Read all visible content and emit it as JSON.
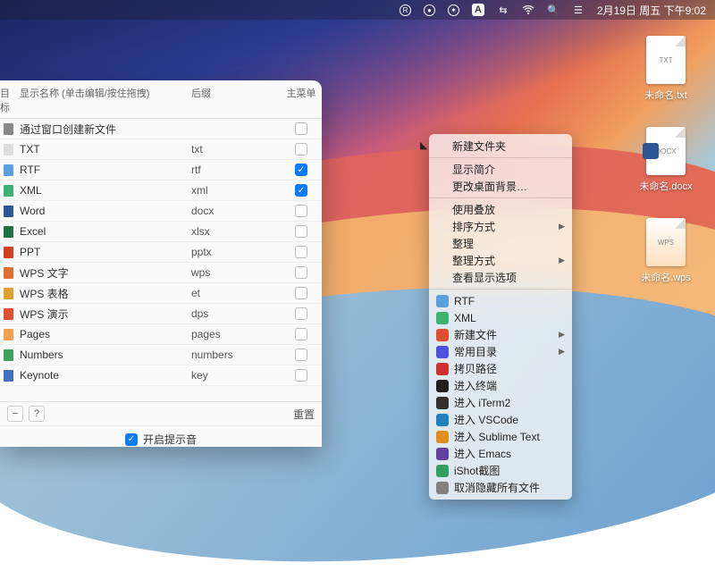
{
  "menubar": {
    "datetime": "2月19日 周五 下午9:02",
    "icons": [
      "R",
      "●",
      "⊕",
      "A",
      "⇄",
      "wifi",
      "⌕",
      "≡"
    ]
  },
  "desktop_files": [
    {
      "name": "未命名.txt",
      "badge": "TXT",
      "kind": "txt"
    },
    {
      "name": "未命名.docx",
      "badge": "DOCX",
      "kind": "docx"
    },
    {
      "name": "未命名.wps",
      "badge": "WPS",
      "kind": "wps"
    }
  ],
  "prefs": {
    "columns": {
      "icon": "目标",
      "name": "显示名称 (单击编辑/按住拖拽)",
      "ext": "后缀",
      "menu": "主菜单"
    },
    "rows": [
      {
        "icon_color": "#888",
        "name": "通过窗口创建新文件",
        "ext": "",
        "checked": false
      },
      {
        "icon_color": "#ddd",
        "name": "TXT",
        "ext": "txt",
        "checked": false
      },
      {
        "icon_color": "#5aa0e0",
        "name": "RTF",
        "ext": "rtf",
        "checked": true
      },
      {
        "icon_color": "#3cb371",
        "name": "XML",
        "ext": "xml",
        "checked": true
      },
      {
        "icon_color": "#2b5797",
        "name": "Word",
        "ext": "docx",
        "checked": false
      },
      {
        "icon_color": "#1e7145",
        "name": "Excel",
        "ext": "xlsx",
        "checked": false
      },
      {
        "icon_color": "#d04020",
        "name": "PPT",
        "ext": "pptx",
        "checked": false
      },
      {
        "icon_color": "#e07030",
        "name": "WPS 文字",
        "ext": "wps",
        "checked": false
      },
      {
        "icon_color": "#e0a030",
        "name": "WPS 表格",
        "ext": "et",
        "checked": false
      },
      {
        "icon_color": "#e05030",
        "name": "WPS 演示",
        "ext": "dps",
        "checked": false
      },
      {
        "icon_color": "#f0a050",
        "name": "Pages",
        "ext": "pages",
        "checked": false
      },
      {
        "icon_color": "#40a060",
        "name": "Numbers",
        "ext": "numbers",
        "checked": false
      },
      {
        "icon_color": "#4070c0",
        "name": "Keynote",
        "ext": "key",
        "checked": false
      }
    ],
    "footer": {
      "remove": "−",
      "help": "?",
      "reset": "重置"
    },
    "bottom_toggle": "开启提示音"
  },
  "context_menu": {
    "groups": [
      [
        {
          "label": "新建文件夹",
          "icon": null,
          "submenu": false,
          "cursor": true
        }
      ],
      [
        {
          "label": "显示简介",
          "icon": null,
          "submenu": false
        },
        {
          "label": "更改桌面背景…",
          "icon": null,
          "submenu": false
        }
      ],
      [
        {
          "label": "使用叠放",
          "icon": null,
          "submenu": false
        },
        {
          "label": "排序方式",
          "icon": null,
          "submenu": true
        },
        {
          "label": "整理",
          "icon": null,
          "submenu": false
        },
        {
          "label": "整理方式",
          "icon": null,
          "submenu": true
        },
        {
          "label": "查看显示选项",
          "icon": null,
          "submenu": false
        }
      ],
      [
        {
          "label": "RTF",
          "icon": "#5aa0e0",
          "submenu": false
        },
        {
          "label": "XML",
          "icon": "#3cb371",
          "submenu": false
        },
        {
          "label": "新建文件",
          "icon": "#e05030",
          "submenu": true
        },
        {
          "label": "常用目录",
          "icon": "#5050e0",
          "submenu": true
        },
        {
          "label": "拷贝路径",
          "icon": "#d03030",
          "submenu": false
        },
        {
          "label": "进入终端",
          "icon": "#202020",
          "submenu": false
        },
        {
          "label": "进入 iTerm2",
          "icon": "#303030",
          "submenu": false
        },
        {
          "label": "进入 VSCode",
          "icon": "#2080c0",
          "submenu": false
        },
        {
          "label": "进入 Sublime Text",
          "icon": "#e09020",
          "submenu": false
        },
        {
          "label": "进入 Emacs",
          "icon": "#6040a0",
          "submenu": false
        },
        {
          "label": "iShot截图",
          "icon": "#30a060",
          "submenu": false
        },
        {
          "label": "取消隐藏所有文件",
          "icon": "#808080",
          "submenu": false
        }
      ]
    ]
  }
}
